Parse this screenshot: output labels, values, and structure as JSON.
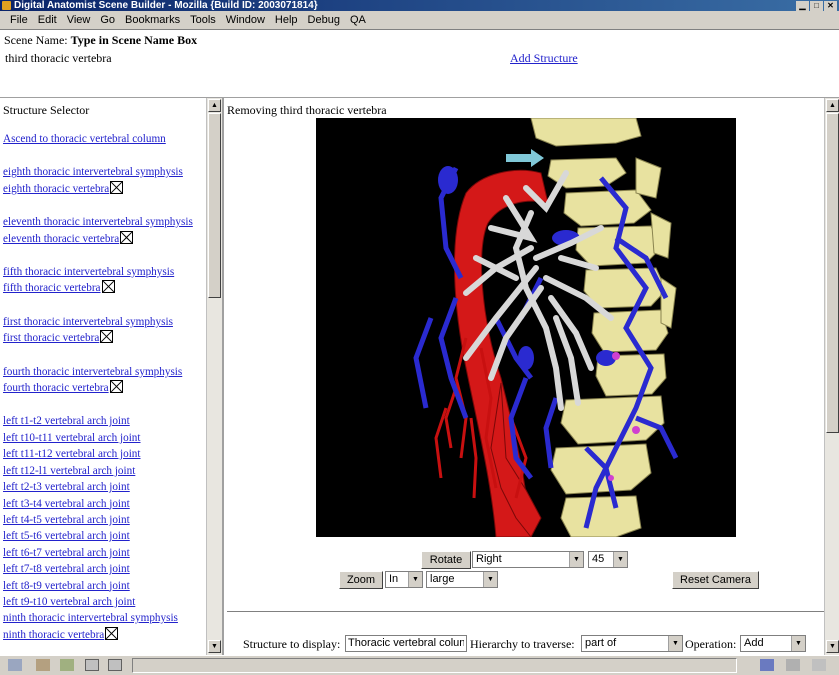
{
  "window": {
    "title": "Digital Anatomist Scene Builder - Mozilla {Build ID: 2003071814}"
  },
  "menu": [
    "File",
    "Edit",
    "View",
    "Go",
    "Bookmarks",
    "Tools",
    "Window",
    "Help",
    "Debug",
    "QA"
  ],
  "scene": {
    "name_label": "Scene Name:",
    "name_value": "Type in Scene Name Box",
    "current_structure": "third thoracic vertebra",
    "add_structure_link": "Add Structure"
  },
  "selector": {
    "heading": "Structure Selector",
    "ascend_link": "Ascend to thoracic vertebral column",
    "pairs": [
      {
        "symphysis": "eighth thoracic intervertebral symphysis",
        "vertebra": "eighth thoracic vertebra"
      },
      {
        "symphysis": "eleventh thoracic intervertebral symphysis",
        "vertebra": "eleventh thoracic vertebra"
      },
      {
        "symphysis": "fifth thoracic intervertebral symphysis",
        "vertebra": "fifth thoracic vertebra"
      },
      {
        "symphysis": "first thoracic intervertebral symphysis",
        "vertebra": "first thoracic vertebra"
      },
      {
        "symphysis": "fourth thoracic intervertebral symphysis",
        "vertebra": "fourth thoracic vertebra"
      }
    ],
    "joints": [
      "left t1-t2 vertebral arch joint",
      "left t10-t11 vertebral arch joint",
      "left t11-t12 vertebral arch joint",
      "left t12-l1 vertebral arch joint",
      "left t2-t3 vertebral arch joint",
      "left t3-t4 vertebral arch joint",
      "left t4-t5 vertebral arch joint",
      "left t5-t6 vertebral arch joint",
      "left t6-t7 vertebral arch joint",
      "left t7-t8 vertebral arch joint",
      "left t8-t9 vertebral arch joint",
      "left t9-t10 vertebral arch joint"
    ],
    "tail": {
      "symphysis": "ninth thoracic intervertebral symphysis",
      "vertebra": "ninth thoracic vertebra"
    }
  },
  "viewer": {
    "status": "Removing third thoracic vertebra",
    "rotate_button": "Rotate",
    "rotate_direction": "Right",
    "rotate_degrees": "45",
    "zoom_button": "Zoom",
    "zoom_direction": "In",
    "zoom_amount": "large",
    "reset_camera_button": "Reset Camera"
  },
  "controls": {
    "structure_label": "Structure to display:",
    "structure_value": "Thoracic vertebral colun",
    "hierarchy_label": "Hierarchy to traverse:",
    "hierarchy_value": "part of",
    "operation_label": "Operation:",
    "operation_value": "Add"
  },
  "colors": {
    "link": "#2222cc",
    "bone": "#e8e2a0",
    "artery": "#d41818",
    "vein": "#2a2ad0",
    "nerve": "#d8d8d8"
  }
}
